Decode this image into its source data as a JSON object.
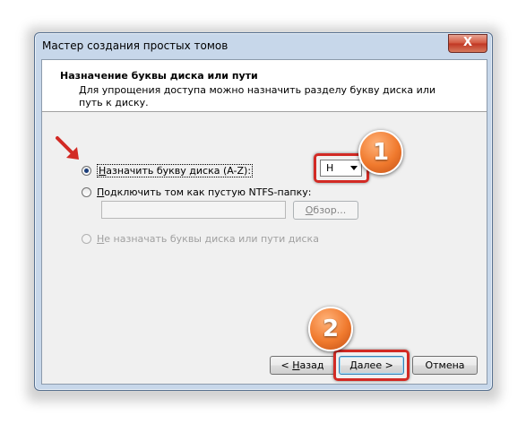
{
  "window": {
    "title": "Мастер создания простых томов",
    "close_label": "X"
  },
  "header": {
    "title": "Назначение буквы диска или пути",
    "description": "Для упрощения доступа можно назначить разделу букву диска или путь к диску."
  },
  "options": {
    "assign_letter": {
      "mnemonic": "Н",
      "rest": "азначить букву диска (A-Z):",
      "selected": true
    },
    "mount_folder": {
      "mnemonic": "П",
      "rest": "одключить том как пустую NTFS-папку:",
      "selected": false
    },
    "no_letter": {
      "mnemonic": "Н",
      "rest": "е назначать буквы диска или пути диска",
      "selected": false,
      "disabled": true
    }
  },
  "drive_letter": {
    "value": "H"
  },
  "browse_button": {
    "mnemonic": "О",
    "rest": "бзор..."
  },
  "footer": {
    "back": {
      "prefix": "< ",
      "mnemonic": "Н",
      "rest": "азад"
    },
    "next": {
      "mnemonic": "Д",
      "rest": "алее >"
    },
    "cancel": "Отмена"
  },
  "annotations": {
    "badge1": "1",
    "badge2": "2",
    "highlight_color": "#d22a24",
    "badge_color": "#f07a2e"
  }
}
